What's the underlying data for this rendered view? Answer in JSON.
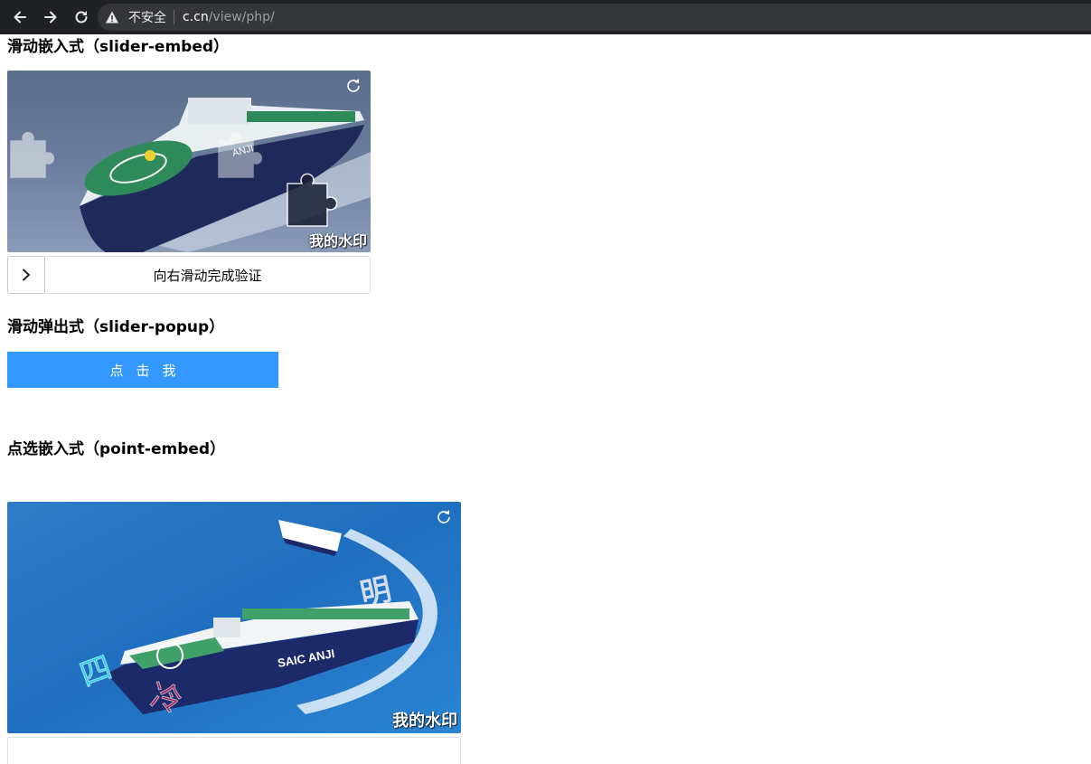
{
  "browser": {
    "security_label": "不安全",
    "url_host": "c.cn",
    "url_path": "/view/php/",
    "icons": [
      "back-arrow-icon",
      "forward-arrow-icon",
      "reload-icon",
      "warning-icon"
    ]
  },
  "sections": {
    "slider_embed": {
      "title": "滑动嵌入式（slider-embed）",
      "watermark": "我的水印",
      "hint": "向右滑动完成验证"
    },
    "slider_popup": {
      "title": "滑动弹出式（slider-popup）",
      "button_label": "点击我"
    },
    "point_embed": {
      "title": "点选嵌入式（point-embed）",
      "watermark": "我的水印",
      "ship_text": "SAIC ANJI",
      "characters": [
        "明",
        "四",
        "冷"
      ]
    }
  },
  "colors": {
    "browser_bar": "#202124",
    "omnibox": "#35363a",
    "button_blue": "#3399ff"
  }
}
